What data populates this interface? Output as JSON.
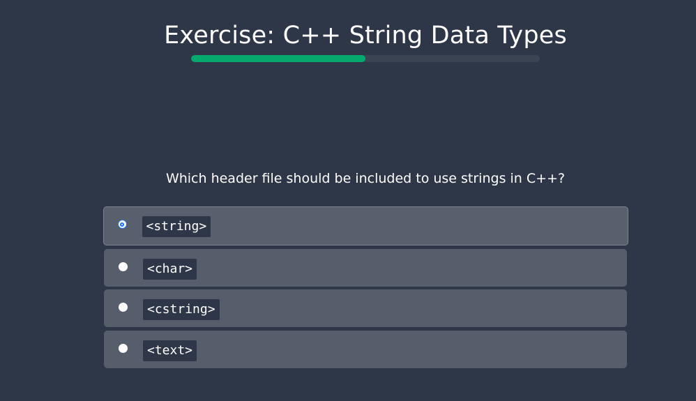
{
  "exercise": {
    "title": "Exercise: C++ String Data Types",
    "progress": 0.5
  },
  "question": {
    "text": "Which header file should be included to use strings in C++?"
  },
  "options": [
    {
      "label": "<string>",
      "selected": true
    },
    {
      "label": "<char>",
      "selected": false
    },
    {
      "label": "<cstring>",
      "selected": false
    },
    {
      "label": "<text>",
      "selected": false
    }
  ],
  "colors": {
    "background": "#2d3748",
    "progress_fill": "#04aa6d",
    "option_bg": "#565e6b",
    "radio_selected": "#1a73e8"
  }
}
